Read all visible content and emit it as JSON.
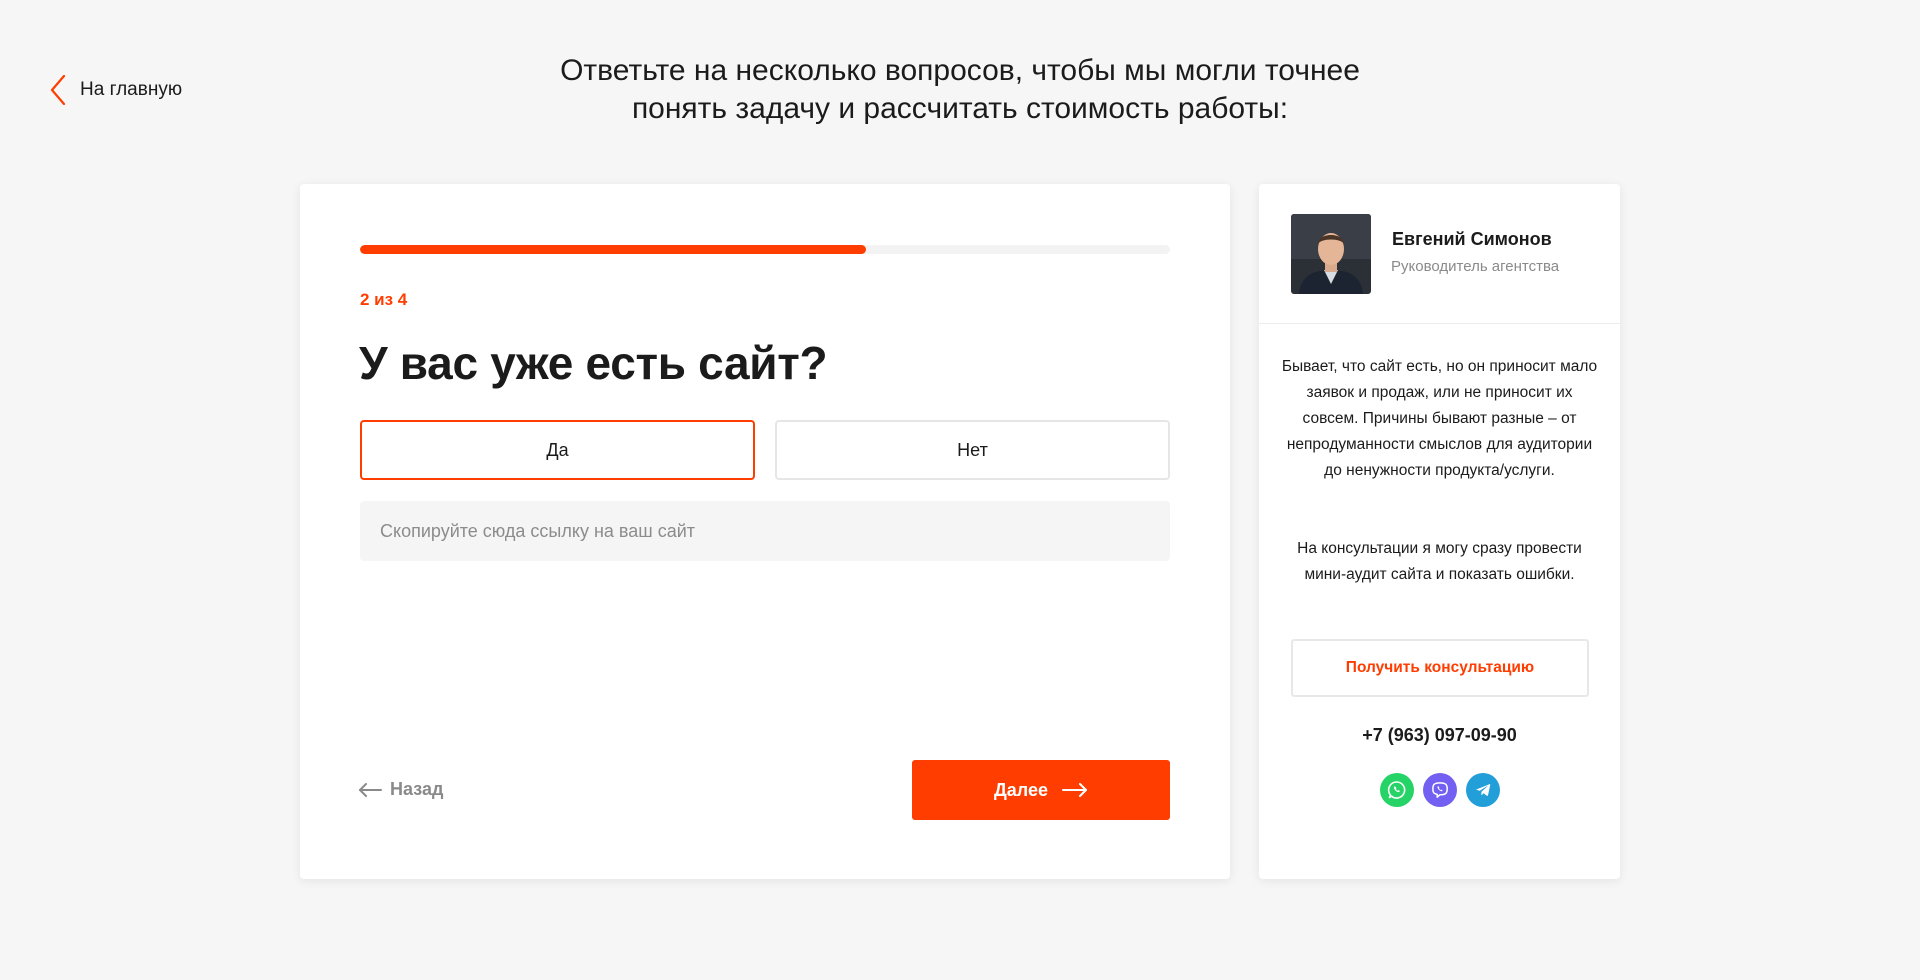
{
  "nav": {
    "back_home_label": "На главную"
  },
  "header": {
    "title_line1": "Ответьте на несколько вопросов, чтобы мы могли точнее",
    "title_line2": "понять задачу и рассчитать стоимость работы:"
  },
  "quiz": {
    "progress": 0.625,
    "step_label": "2 из 4",
    "question": "У вас уже есть сайт?",
    "answers": [
      {
        "label": "Да",
        "selected": true
      },
      {
        "label": "Нет",
        "selected": false
      }
    ],
    "url_placeholder": "Скопируйте сюда ссылку на ваш сайт",
    "url_value": "",
    "back_label": "Назад",
    "next_label": "Далее"
  },
  "consultant": {
    "name": "Евгений Симонов",
    "role": "Руководитель агентства",
    "text_1": "Бывает, что сайт есть, но он приносит мало заявок и продаж, или не приносит их совсем. Причины бывают разные – от непродуманности смыслов для аудитории до ненужности продукта/услуги.",
    "text_2": "На консультации я могу сразу провести мини-аудит сайта и показать ошибки.",
    "cta_label": "Получить консультацию",
    "phone": "+7 (963) 097-09-90",
    "messengers": [
      {
        "icon": "whatsapp-icon",
        "color": "#25d366"
      },
      {
        "icon": "viber-icon",
        "color": "#7360f2"
      },
      {
        "icon": "telegram-icon",
        "color": "#229ed9"
      }
    ]
  },
  "colors": {
    "accent": "#ff3d00",
    "background": "#f6f6f6",
    "card": "#ffffff"
  }
}
